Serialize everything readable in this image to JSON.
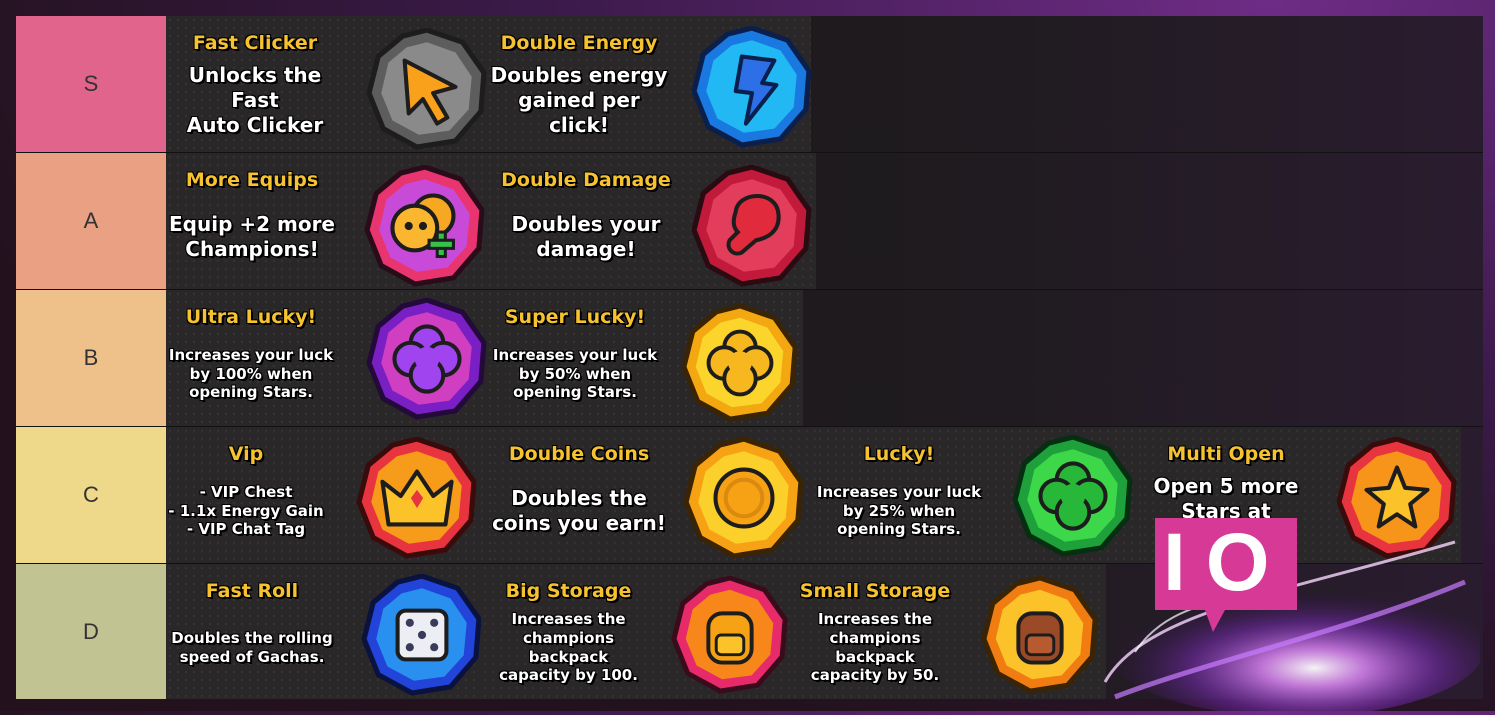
{
  "tiers": [
    {
      "label": "S",
      "color": "#e0648c",
      "items": [
        {
          "title": "Fast Clicker",
          "desc": "Unlocks the Fast\nAuto Clicker",
          "icon": "cursor-icon",
          "badge": "gray"
        },
        {
          "title": "Double Energy",
          "desc": "Doubles energy\ngained per click!",
          "icon": "lightning-icon",
          "badge": "blue"
        }
      ]
    },
    {
      "label": "A",
      "color": "#e9a083",
      "items": [
        {
          "title": "More Equips",
          "desc": "Equip +2 more\nChampions!",
          "icon": "characters-plus-icon",
          "badge": "pink"
        },
        {
          "title": "Double Damage",
          "desc": "Doubles your\ndamage!",
          "icon": "boxing-glove-icon",
          "badge": "red"
        }
      ]
    },
    {
      "label": "B",
      "color": "#eec18a",
      "items": [
        {
          "title": "Ultra Lucky!",
          "desc": "Increases your luck\nby 100% when\nopening Stars.",
          "icon": "clover-purple-icon",
          "badge": "purple"
        },
        {
          "title": "Super Lucky!",
          "desc": "Increases your luck\nby 50% when\nopening Stars.",
          "icon": "clover-gold-icon",
          "badge": "gold"
        }
      ]
    },
    {
      "label": "C",
      "color": "#eed98a",
      "items": [
        {
          "title": "Vip",
          "desc": "- VIP Chest\n- 1.1x Energy Gain\n- VIP Chat Tag",
          "icon": "crown-icon",
          "badge": "orange"
        },
        {
          "title": "Double Coins",
          "desc": "Doubles the\ncoins you earn!",
          "icon": "coin-icon",
          "badge": "orange"
        },
        {
          "title": "Lucky!",
          "desc": "Increases your luck\nby 25% when\nopening Stars.",
          "icon": "clover-green-icon",
          "badge": "green"
        },
        {
          "title": "Multi Open",
          "desc": "Open 5 more\nStars at once!",
          "icon": "stars-icon",
          "badge": "orange"
        }
      ]
    },
    {
      "label": "D",
      "color": "#c2c392",
      "items": [
        {
          "title": "Fast Roll",
          "desc": "Doubles the rolling\nspeed of Gachas.",
          "icon": "dice-icon",
          "badge": "blue"
        },
        {
          "title": "Big Storage",
          "desc": "Increases the\nchampions backpack\ncapacity by 100.",
          "icon": "backpack-icon",
          "badge": "pinkorange"
        },
        {
          "title": "Small Storage",
          "desc": "Increases the\nchampions backpack\ncapacity by 50.",
          "icon": "backpack-small-icon",
          "badge": "orange"
        }
      ]
    }
  ],
  "logo": {
    "text": "IO",
    "icon": "tiermaker-logo-icon"
  }
}
